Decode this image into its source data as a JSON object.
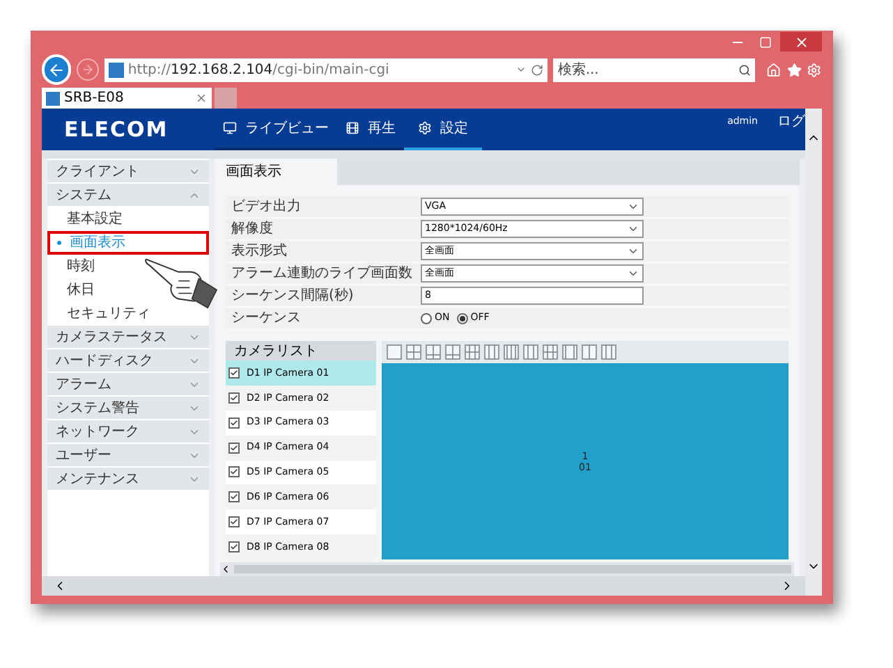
{
  "browser": {
    "url": "http://**192.168.2.104**/cgi-bin/main-cgi",
    "search_placeholder": "検索...",
    "tab_title": "SRB-E08"
  },
  "header": {
    "logo": "ELECOM",
    "nav": [
      {
        "label": "ライブビュー",
        "selected": false
      },
      {
        "label": "再生",
        "selected": false
      },
      {
        "label": "設定",
        "selected": true
      }
    ],
    "user": "admin",
    "logout": "ログ"
  },
  "sidebar": {
    "items": [
      {
        "label": "クライアント",
        "expanded": false
      },
      {
        "label": "システム",
        "expanded": true,
        "children": [
          {
            "label": "基本設定",
            "selected": false
          },
          {
            "label": "画面表示",
            "selected": true
          },
          {
            "label": "時刻",
            "selected": false
          },
          {
            "label": "休日",
            "selected": false
          },
          {
            "label": "セキュリティ",
            "selected": false
          }
        ]
      },
      {
        "label": "カメラステータス",
        "expanded": false
      },
      {
        "label": "ハードディスク",
        "expanded": false
      },
      {
        "label": "アラーム",
        "expanded": false
      },
      {
        "label": "システム警告",
        "expanded": false
      },
      {
        "label": "ネットワーク",
        "expanded": false
      },
      {
        "label": "ユーザー",
        "expanded": false
      },
      {
        "label": "メンテナンス",
        "expanded": false
      }
    ]
  },
  "panel": {
    "tab": "画面表示",
    "fields": [
      {
        "kind": "select",
        "label": "ビデオ出力",
        "value": "VGA"
      },
      {
        "kind": "select",
        "label": "解像度",
        "value": "1280*1024/60Hz"
      },
      {
        "kind": "select",
        "label": "表示形式",
        "value": "全画面"
      },
      {
        "kind": "select",
        "label": "アラーム連動のライブ画面数",
        "value": "全画面"
      },
      {
        "kind": "text",
        "label": "シーケンス間隔(秒)",
        "value": "8"
      },
      {
        "kind": "radio",
        "label": "シーケンス",
        "options": [
          {
            "label": "ON",
            "selected": false
          },
          {
            "label": "OFF",
            "selected": true
          }
        ]
      }
    ],
    "camera_list": {
      "title": "カメラリスト",
      "items": [
        {
          "label": "D1 IP Camera 01",
          "checked": true,
          "selected": true
        },
        {
          "label": "D2 IP Camera 02",
          "checked": true,
          "selected": false
        },
        {
          "label": "D3 IP Camera 03",
          "checked": true,
          "selected": false
        },
        {
          "label": "D4 IP Camera 04",
          "checked": true,
          "selected": false
        },
        {
          "label": "D5 IP Camera 05",
          "checked": true,
          "selected": false
        },
        {
          "label": "D6 IP Camera 06",
          "checked": true,
          "selected": false
        },
        {
          "label": "D7 IP Camera 07",
          "checked": true,
          "selected": false
        },
        {
          "label": "D8 IP Camera 08",
          "checked": true,
          "selected": false
        }
      ]
    },
    "preview": {
      "cell_number": "1",
      "channel": "01"
    }
  }
}
